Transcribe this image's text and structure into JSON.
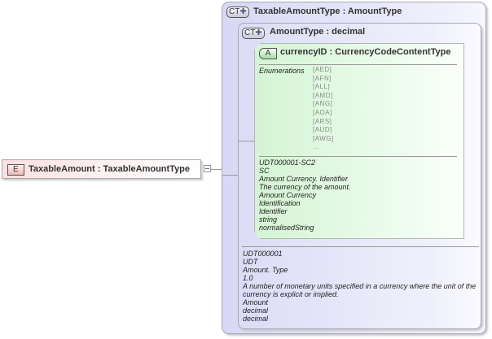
{
  "element": {
    "badge": "E",
    "title": "TaxableAmount : TaxableAmountType"
  },
  "outer": {
    "badge": "CT",
    "title": "TaxableAmountType : AmountType"
  },
  "inner": {
    "badge": "CT",
    "title": "AmountType : decimal",
    "annotations": [
      "UDT000001",
      "UDT",
      "Amount. Type",
      "1.0",
      "A number of monetary units specified in a currency where the unit of the",
      "currency is explicit or implied.",
      "Amount",
      "decimal",
      "decimal"
    ]
  },
  "attribute": {
    "badge": "A",
    "title": "currencyID : CurrencyCodeContentType",
    "enum_label": "Enumerations",
    "enumerations": [
      "[AED]",
      "[AFN]",
      "[ALL]",
      "[AMD]",
      "[ANG]",
      "[AOA]",
      "[ARS]",
      "[AUD]",
      "[AWG]",
      "..."
    ],
    "annotations": [
      "UDT000001-SC2",
      "SC",
      "Amount Currency. Identifier",
      "The currency of the amount.",
      "Amount Currency",
      "Identification",
      "Identifier",
      "string",
      "normalisedString"
    ]
  }
}
